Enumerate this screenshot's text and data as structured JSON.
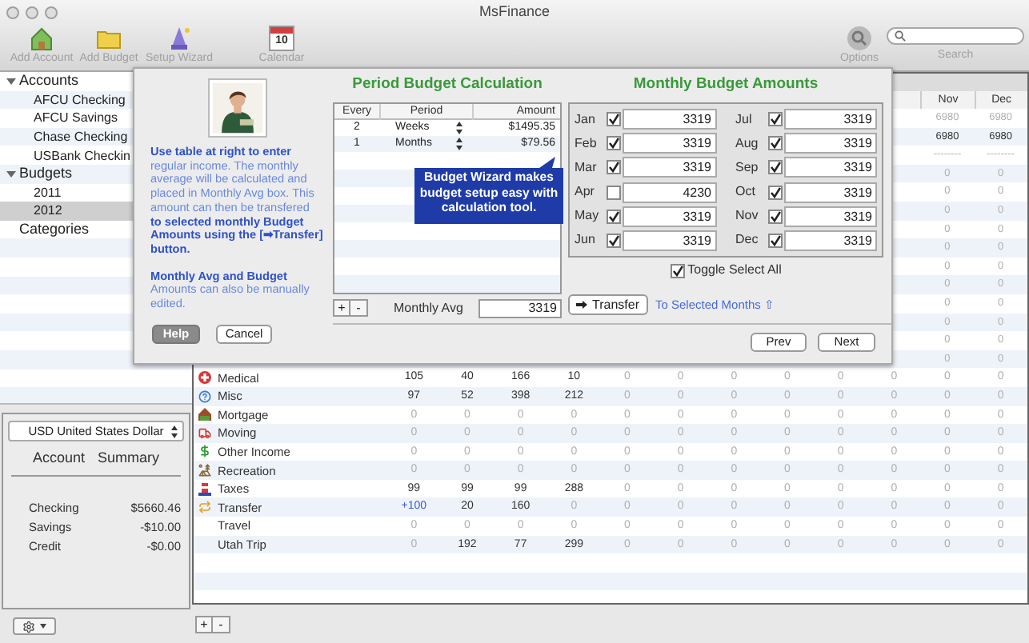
{
  "window": {
    "title": "MsFinance"
  },
  "toolbar": {
    "items": [
      {
        "kind": "account",
        "label": "Add Account"
      },
      {
        "kind": "budget",
        "label": "Add Budget"
      },
      {
        "kind": "wizard",
        "label": "Setup Wizard"
      },
      {
        "kind": "calendar",
        "label": "Calendar",
        "day": "10"
      }
    ],
    "options": {
      "label": "Options"
    },
    "search": {
      "label": "Search"
    }
  },
  "sidebar": {
    "tree": [
      {
        "label": "Accounts",
        "expanded": true,
        "selected": false,
        "children": [
          {
            "label": "AFCU Checking",
            "selected": false
          },
          {
            "label": "AFCU Savings",
            "selected": false
          },
          {
            "label": "Chase Checking",
            "selected": false
          },
          {
            "label": "USBank Checkin",
            "selected": false
          }
        ]
      },
      {
        "label": "Budgets",
        "expanded": true,
        "selected": false,
        "children": [
          {
            "label": "2011",
            "selected": false
          },
          {
            "label": "2012",
            "selected": true
          }
        ]
      },
      {
        "label": "Categories",
        "selected": false
      }
    ]
  },
  "summary": {
    "currency": "USD United States Dollar",
    "heading": [
      "Account",
      "Summary"
    ],
    "rows": [
      {
        "label": "Checking",
        "amount": "$5660.46"
      },
      {
        "label": "Savings",
        "amount": "-$10.00"
      },
      {
        "label": "Credit",
        "amount": "-$0.00"
      }
    ]
  },
  "table": {
    "header": [
      "Nov",
      "Dec"
    ],
    "upper_rows": [
      {
        "cells": [
          "6980",
          "6980"
        ],
        "muted": true
      },
      {
        "cells": [
          "6980",
          "6980"
        ],
        "muted": false
      },
      {
        "cells": [
          "--------",
          "--------"
        ],
        "muted": true
      },
      {
        "cells": [
          "0",
          "0"
        ],
        "muted": true
      },
      {
        "cells": [
          "0",
          "0"
        ],
        "muted": true
      },
      {
        "cells": [
          "0",
          "0"
        ],
        "muted": true
      },
      {
        "cells": [
          "0",
          "0"
        ],
        "muted": true
      },
      {
        "cells": [
          "0",
          "0"
        ],
        "muted": true
      },
      {
        "cells": [
          "0",
          "0"
        ],
        "muted": true
      },
      {
        "cells": [
          "0",
          "0"
        ],
        "muted": true
      },
      {
        "cells": [
          "0",
          "0"
        ],
        "muted": true
      },
      {
        "cells": [
          "0",
          "0"
        ],
        "muted": true
      },
      {
        "cells": [
          "0",
          "0"
        ],
        "muted": true
      },
      {
        "cells": [
          "0",
          "0"
        ],
        "muted": true
      }
    ],
    "rows": [
      {
        "kind": "medical",
        "name": "Medical",
        "values": [
          "105",
          "40",
          "166",
          "10",
          "0",
          "0",
          "0",
          "0",
          "0",
          "0",
          "0",
          "0"
        ]
      },
      {
        "kind": "misc",
        "name": "Misc",
        "values": [
          "97",
          "52",
          "398",
          "212",
          "0",
          "0",
          "0",
          "0",
          "0",
          "0",
          "0",
          "0"
        ]
      },
      {
        "kind": "mortgage",
        "name": "Mortgage",
        "values": [
          "0",
          "0",
          "0",
          "0",
          "0",
          "0",
          "0",
          "0",
          "0",
          "0",
          "0",
          "0"
        ]
      },
      {
        "kind": "moving",
        "name": "Moving",
        "values": [
          "0",
          "0",
          "0",
          "0",
          "0",
          "0",
          "0",
          "0",
          "0",
          "0",
          "0",
          "0"
        ]
      },
      {
        "kind": "income",
        "name": "Other Income",
        "values": [
          "0",
          "0",
          "0",
          "0",
          "0",
          "0",
          "0",
          "0",
          "0",
          "0",
          "0",
          "0"
        ]
      },
      {
        "kind": "recreation",
        "name": "Recreation",
        "values": [
          "0",
          "0",
          "0",
          "0",
          "0",
          "0",
          "0",
          "0",
          "0",
          "0",
          "0",
          "0"
        ]
      },
      {
        "kind": "taxes",
        "name": "Taxes",
        "values": [
          "99",
          "99",
          "99",
          "288",
          "0",
          "0",
          "0",
          "0",
          "0",
          "0",
          "0",
          "0"
        ]
      },
      {
        "kind": "transfer",
        "name": "Transfer",
        "values": [
          "+100",
          "20",
          "160",
          "0",
          "0",
          "0",
          "0",
          "0",
          "0",
          "0",
          "0",
          "0"
        ]
      },
      {
        "kind": "plain",
        "name": "Travel",
        "values": [
          "0",
          "0",
          "0",
          "0",
          "0",
          "0",
          "0",
          "0",
          "0",
          "0",
          "0",
          "0"
        ]
      },
      {
        "kind": "plain",
        "name": "Utah Trip",
        "values": [
          "0",
          "192",
          "77",
          "299",
          "0",
          "0",
          "0",
          "0",
          "0",
          "0",
          "0",
          "0"
        ]
      }
    ],
    "add": "+",
    "remove": "-"
  },
  "sheet": {
    "help": [
      "**Use table at right to enter** regular income.  The monthly average will be calculated and placed in Monthly Avg box.  This amount can then be transfered **to selected monthly Budget Amounts using the [➡Transfer] button.**",
      "**Monthly Avg and Budget** Amounts can also be manually edited."
    ],
    "period": {
      "title": "Period Budget Calculation",
      "columns": [
        "Every",
        "Period",
        "Amount"
      ],
      "rows": [
        {
          "every": "2",
          "period": "Weeks",
          "amount": "$1495.35"
        },
        {
          "every": "1",
          "period": "Months",
          "amount": "$79.56"
        }
      ],
      "add": "+",
      "remove": "-",
      "avg_label": "Monthly Avg",
      "avg_value": "3319"
    },
    "tooltip": "Budget Wizard makes budget setup easy with calculation tool.",
    "monthly": {
      "title": "Monthly Budget Amounts",
      "months": [
        {
          "label": "Jan",
          "checked": true,
          "value": "3319"
        },
        {
          "label": "Feb",
          "checked": true,
          "value": "3319"
        },
        {
          "label": "Mar",
          "checked": true,
          "value": "3319"
        },
        {
          "label": "Apr",
          "checked": false,
          "value": "4230"
        },
        {
          "label": "May",
          "checked": true,
          "value": "3319"
        },
        {
          "label": "Jun",
          "checked": true,
          "value": "3319"
        },
        {
          "label": "Jul",
          "checked": true,
          "value": "3319"
        },
        {
          "label": "Aug",
          "checked": true,
          "value": "3319"
        },
        {
          "label": "Sep",
          "checked": true,
          "value": "3319"
        },
        {
          "label": "Oct",
          "checked": true,
          "value": "3319"
        },
        {
          "label": "Nov",
          "checked": true,
          "value": "3319"
        },
        {
          "label": "Dec",
          "checked": true,
          "value": "3319"
        }
      ],
      "toggle": {
        "label": "Toggle Select All",
        "checked": true
      },
      "transfer": "Transfer",
      "target": "To Selected Months ⇧"
    },
    "buttons": {
      "help": "Help",
      "cancel": "Cancel",
      "prev": "Prev",
      "next": "Next"
    }
  }
}
